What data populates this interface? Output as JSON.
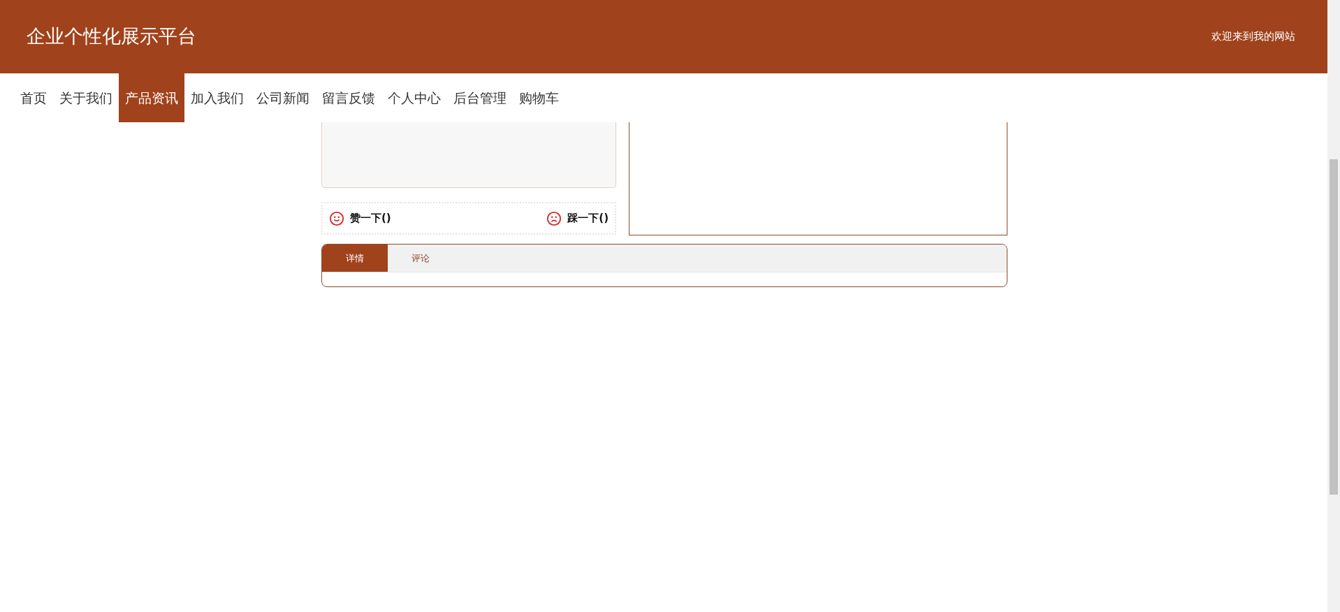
{
  "header": {
    "title": "企业个性化展示平台",
    "welcome": "欢迎来到我的网站"
  },
  "nav": [
    {
      "label": "首页",
      "selected": false
    },
    {
      "label": "关于我们",
      "selected": false
    },
    {
      "label": "产品资讯",
      "selected": true
    },
    {
      "label": "加入我们",
      "selected": false
    },
    {
      "label": "公司新闻",
      "selected": false
    },
    {
      "label": "留言反馈",
      "selected": false
    },
    {
      "label": "个人中心",
      "selected": false
    },
    {
      "label": "后台管理",
      "selected": false
    },
    {
      "label": "购物车",
      "selected": false
    }
  ],
  "votes": [
    {
      "kind": "like",
      "label": "赞一下()"
    },
    {
      "kind": "dislike",
      "label": "踩一下()"
    }
  ],
  "tabs": [
    {
      "label": "详情",
      "selected": true
    },
    {
      "label": "评论",
      "selected": false
    }
  ]
}
